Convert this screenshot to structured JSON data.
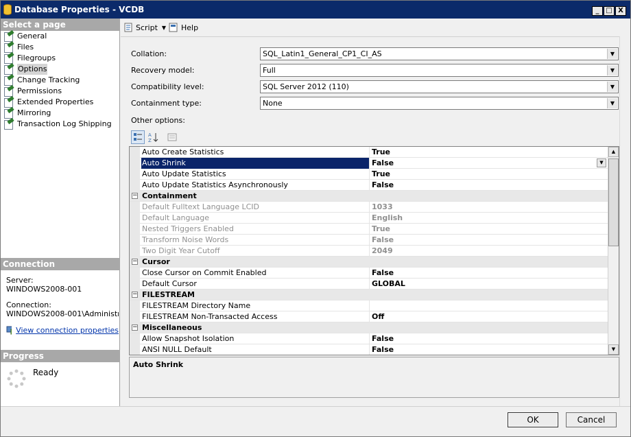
{
  "window": {
    "title": "Database Properties - VCDB",
    "controls": {
      "minimize": "_",
      "maximize": "□",
      "close": "X"
    }
  },
  "sidebar": {
    "header": "Select a page",
    "pages": [
      {
        "label": "General",
        "selected": false
      },
      {
        "label": "Files",
        "selected": false
      },
      {
        "label": "Filegroups",
        "selected": false
      },
      {
        "label": "Options",
        "selected": true
      },
      {
        "label": "Change Tracking",
        "selected": false
      },
      {
        "label": "Permissions",
        "selected": false
      },
      {
        "label": "Extended Properties",
        "selected": false
      },
      {
        "label": "Mirroring",
        "selected": false
      },
      {
        "label": "Transaction Log Shipping",
        "selected": false
      }
    ],
    "connection": {
      "header": "Connection",
      "server_label": "Server:",
      "server_value": "WINDOWS2008-001",
      "connection_label": "Connection:",
      "connection_value": "WINDOWS2008-001\\Administrato",
      "link": "View connection properties"
    },
    "progress": {
      "header": "Progress",
      "status": "Ready"
    }
  },
  "toolbar": {
    "script_label": "Script",
    "help_label": "Help"
  },
  "form": {
    "collation_label": "Collation:",
    "collation_value": "SQL_Latin1_General_CP1_CI_AS",
    "recovery_label": "Recovery model:",
    "recovery_value": "Full",
    "compat_label": "Compatibility level:",
    "compat_value": "SQL Server 2012 (110)",
    "containment_label": "Containment type:",
    "containment_value": "None",
    "other_options_label": "Other options:"
  },
  "grid": {
    "rows": [
      {
        "kind": "prop",
        "name": "Auto Create Statistics",
        "value": "True"
      },
      {
        "kind": "prop",
        "name": "Auto Shrink",
        "value": "False",
        "selected": true
      },
      {
        "kind": "prop",
        "name": "Auto Update Statistics",
        "value": "True"
      },
      {
        "kind": "prop",
        "name": "Auto Update Statistics Asynchronously",
        "value": "False"
      },
      {
        "kind": "category",
        "name": "Containment"
      },
      {
        "kind": "prop",
        "name": "Default Fulltext Language LCID",
        "value": "1033",
        "disabled": true
      },
      {
        "kind": "prop",
        "name": "Default Language",
        "value": "English",
        "disabled": true
      },
      {
        "kind": "prop",
        "name": "Nested Triggers Enabled",
        "value": "True",
        "disabled": true
      },
      {
        "kind": "prop",
        "name": "Transform Noise Words",
        "value": "False",
        "disabled": true
      },
      {
        "kind": "prop",
        "name": "Two Digit Year Cutoff",
        "value": "2049",
        "disabled": true
      },
      {
        "kind": "category",
        "name": "Cursor"
      },
      {
        "kind": "prop",
        "name": "Close Cursor on Commit Enabled",
        "value": "False"
      },
      {
        "kind": "prop",
        "name": "Default Cursor",
        "value": "GLOBAL"
      },
      {
        "kind": "category",
        "name": "FILESTREAM"
      },
      {
        "kind": "prop",
        "name": "FILESTREAM Directory Name",
        "value": ""
      },
      {
        "kind": "prop",
        "name": "FILESTREAM Non-Transacted Access",
        "value": "Off"
      },
      {
        "kind": "category",
        "name": "Miscellaneous"
      },
      {
        "kind": "prop",
        "name": "Allow Snapshot Isolation",
        "value": "False"
      },
      {
        "kind": "prop",
        "name": "ANSI NULL Default",
        "value": "False"
      }
    ],
    "collapse_glyph": "−"
  },
  "description": {
    "title": "Auto Shrink"
  },
  "buttons": {
    "ok": "OK",
    "cancel": "Cancel"
  },
  "colors": {
    "titlebar": "#0b2a6a",
    "selection": "#0a246a",
    "section_header": "#a8a8a8"
  }
}
